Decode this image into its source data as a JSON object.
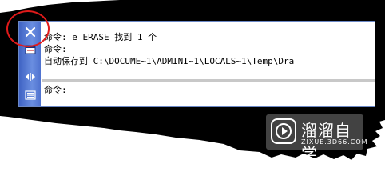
{
  "command_window": {
    "history_lines": [
      "命令: e ERASE 找到 1 个",
      "命令:",
      "自动保存到 C:\\DOCUME~1\\ADMINI~1\\LOCALS~1\\Temp\\Dra"
    ],
    "prompt": "命令:"
  },
  "icons": {
    "close": "close-icon",
    "properties": "properties-icon",
    "toggle": "arrows-icon",
    "history": "list-icon"
  },
  "colors": {
    "sidebar": "#4f72cf",
    "highlight_ring": "#e01a1a"
  },
  "watermark": {
    "title": "溜溜自学",
    "subtitle": "ZIXUE.3D66.COM"
  }
}
